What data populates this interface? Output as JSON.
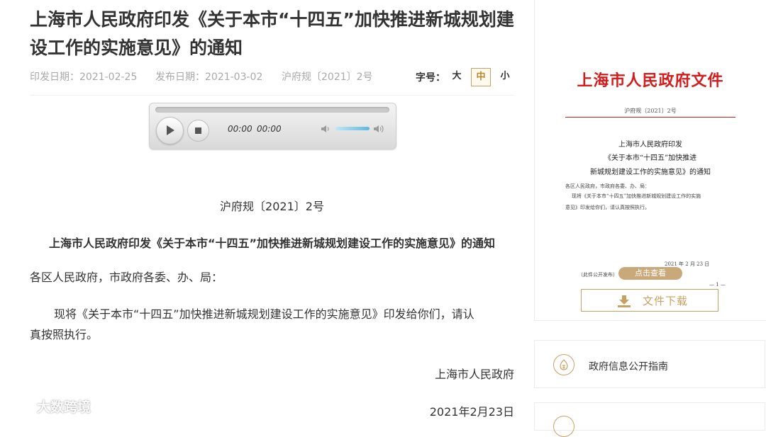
{
  "article": {
    "title": "上海市人民政府印发《关于本市“十四五”加快推进新城规划建设工作的实施意见》的通知",
    "issue_date": "印发日期：2021-02-25",
    "publish_date": "发布日期：2021-03-02",
    "doc_code": "沪府规〔2021〕2号"
  },
  "font_size": {
    "label": "字号：",
    "large": "大",
    "medium": "中",
    "small": "小",
    "selected": "中"
  },
  "audio": {
    "current_time": "00:00",
    "duration": "00:00",
    "progress": 0
  },
  "body": {
    "doc_number": "沪府规〔2021〕2号",
    "heading": "上海市人民政府印发《关于本市“十四五”加快推进新城规划建设工作的实施意见》的通知",
    "salutation": "各区人民政府，市政府各委、办、局：",
    "paragraph_line1": "现将《关于本市“十四五”加快推进新城规划建设工作的实施意见》印发给你们，请认",
    "paragraph_line2": "真按照执行。",
    "signature": "上海市人民政府",
    "date": "2021年2月23日"
  },
  "sidebar": {
    "doc_preview": {
      "header": "上海市人民政府文件",
      "doc_no": "沪府规〔2021〕2号",
      "title_line1": "上海市人民政府印发",
      "title_line2": "《关于本市“十四五”加快推进",
      "title_line3": "新城规划建设工作的实施意见》的通知",
      "addressee": "各区人民政府，市政府各委、办、局：",
      "body_line1": "现将《关于本市“十四五”加快推进新城规划建设工作的实施",
      "body_line2": "意见》印发给你们，请认真按照执行。",
      "date": "2021 年 2 月 23 日",
      "footnote": "（此件公开发布）",
      "page_mark": "— 1 —",
      "view_button": "点击查看"
    },
    "download_button": "文件下载",
    "guide_link": "政府信息公开指南"
  },
  "watermark": "大数跨境",
  "colors": {
    "accent_gold": "#c9a063",
    "document_red": "#d41c1c"
  }
}
